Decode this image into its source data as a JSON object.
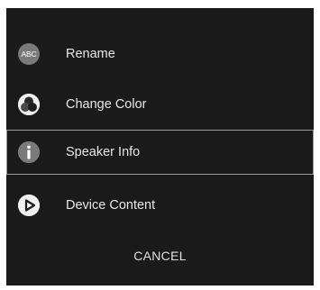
{
  "menu": {
    "items": [
      {
        "label": "Rename",
        "icon": "abc-icon",
        "icon_text": "ABC",
        "selected": false
      },
      {
        "label": "Change Color",
        "icon": "color-palette-icon",
        "selected": false
      },
      {
        "label": "Speaker Info",
        "icon": "info-icon",
        "selected": true
      },
      {
        "label": "Device Content",
        "icon": "play-icon",
        "selected": false
      }
    ],
    "cancel_label": "CANCEL"
  },
  "colors": {
    "background": "#1a1a1a",
    "icon_circle": "#7a7a7a",
    "text": "#e8e8e8",
    "selection_border": "#9a9a9a"
  }
}
